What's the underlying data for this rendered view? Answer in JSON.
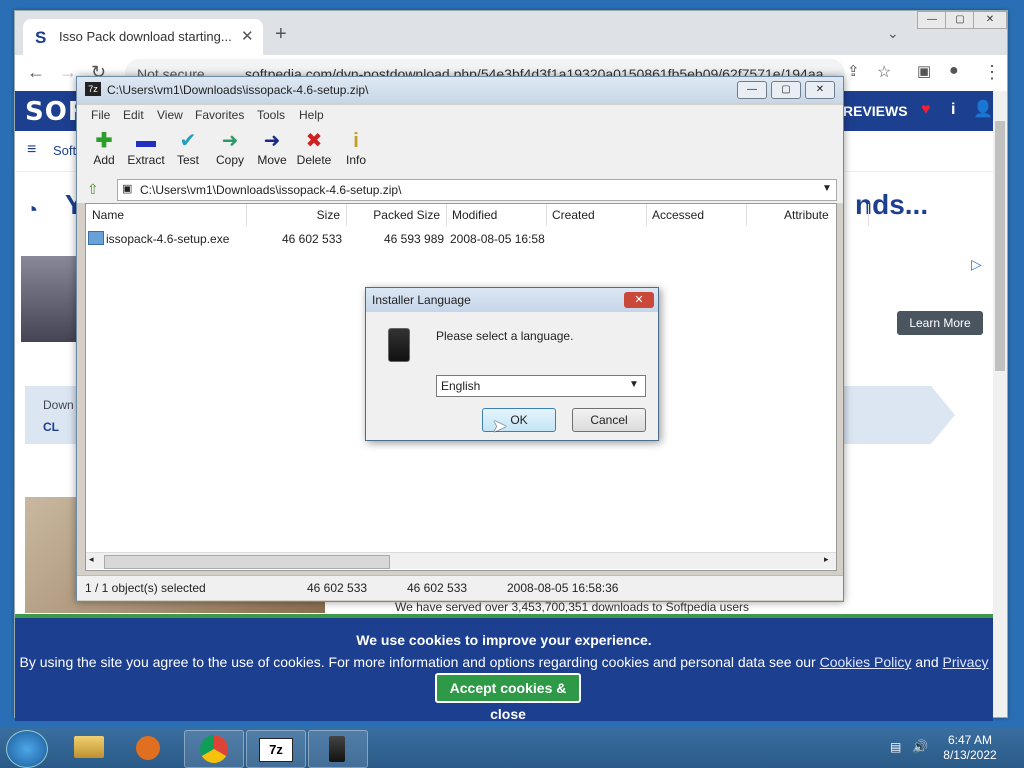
{
  "browser": {
    "tab_title": "Isso Pack download starting...",
    "tab_favicon": "S",
    "address_label": "Not secure",
    "url": "softpedia.com/dyn-postdownload.php/54e3bf4d3f1a19320a0150861fb5eb09/62f7571e/194aa..."
  },
  "site": {
    "logo": "SOFT",
    "nav_short": "Soft",
    "reviews": "REVIEWS",
    "headline_left": "Y",
    "headline_right": "nds...",
    "download_label": "Down",
    "cl_label": "CL",
    "learn_more": "Learn More",
    "served": "We have served over 3,453,700,351 downloads to Softpedia users"
  },
  "cookie": {
    "title": "We use cookies to improve your experience.",
    "text": "By using the site you agree to the use of cookies. For more information and options regarding cookies and personal data see our",
    "cookies_policy": "Cookies Policy",
    "and": "and",
    "privacy_policy": "Privacy Policy",
    "accept": "Accept cookies & close"
  },
  "sevenzip": {
    "title": "C:\\Users\\vm1\\Downloads\\issopack-4.6-setup.zip\\",
    "title_icon": "7z",
    "menu": [
      "File",
      "Edit",
      "View",
      "Favorites",
      "Tools",
      "Help"
    ],
    "tools": [
      {
        "label": "Add",
        "icon": "+",
        "color": "#2aa02a"
      },
      {
        "label": "Extract",
        "icon": "—",
        "color": "#2030c0"
      },
      {
        "label": "Test",
        "icon": "✓",
        "color": "#20a0c0"
      },
      {
        "label": "Copy",
        "icon": "➜",
        "color": "#2a9a6a"
      },
      {
        "label": "Move",
        "icon": "➜",
        "color": "#1a2a8a"
      },
      {
        "label": "Delete",
        "icon": "✖",
        "color": "#d02020"
      },
      {
        "label": "Info",
        "icon": "i",
        "color": "#c0a020"
      }
    ],
    "path": "C:\\Users\\vm1\\Downloads\\issopack-4.6-setup.zip\\",
    "columns": [
      "Name",
      "Size",
      "Packed Size",
      "Modified",
      "Created",
      "Accessed",
      "Attribute"
    ],
    "row": {
      "name": "issopack-4.6-setup.exe",
      "size": "46 602 533",
      "packed": "46 593 989",
      "modified": "2008-08-05 16:58"
    },
    "status": {
      "selected": "1 / 1 object(s) selected",
      "size": "46 602 533",
      "packed": "46 602 533",
      "modified": "2008-08-05 16:58:36"
    }
  },
  "dialog": {
    "title": "Installer Language",
    "message": "Please select a language.",
    "selected_language": "English",
    "ok": "OK",
    "cancel": "Cancel"
  },
  "taskbar": {
    "time": "6:47 AM",
    "date": "8/13/2022",
    "sevenzip_label": "7z"
  }
}
